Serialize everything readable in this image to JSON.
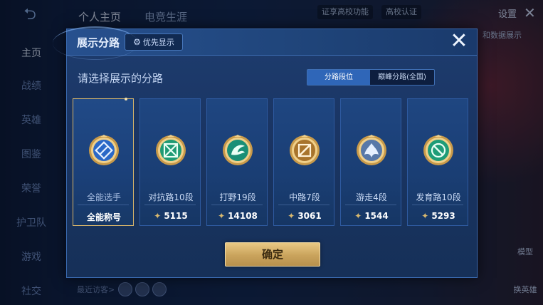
{
  "background": {
    "nav": [
      "主页",
      "战绩",
      "英雄",
      "图鉴",
      "荣誉",
      "护卫队",
      "游戏",
      "社交"
    ],
    "top_tabs": [
      "个人主页",
      "电竞生涯"
    ],
    "verify_tip": "证享高校功能",
    "campus_auth": "高校认证",
    "settings": "设置",
    "data_display": "和数据展示",
    "side_buttons": [
      "模型",
      "换英雄"
    ],
    "recent_visitors": "最近访客>"
  },
  "modal": {
    "title": "展示分路",
    "priority_label": "优先显示",
    "subtitle": "请选择展示的分路",
    "segment": {
      "options": [
        "分路段位",
        "巅峰分路(全国)"
      ],
      "selected": "分路段位"
    },
    "cards": [
      {
        "name": "全能选手",
        "score": "全能称号",
        "selected": true,
        "icon": "all-round-badge-icon",
        "has_star": false
      },
      {
        "name": "对抗路10段",
        "score": "5115",
        "selected": false,
        "icon": "clash-lane-badge-icon",
        "has_star": true
      },
      {
        "name": "打野19段",
        "score": "14108",
        "selected": false,
        "icon": "jungle-badge-icon",
        "has_star": true
      },
      {
        "name": "中路7段",
        "score": "3061",
        "selected": false,
        "icon": "mid-lane-badge-icon",
        "has_star": true
      },
      {
        "name": "游走4段",
        "score": "1544",
        "selected": false,
        "icon": "roam-badge-icon",
        "has_star": true
      },
      {
        "name": "发育路10段",
        "score": "5293",
        "selected": false,
        "icon": "farm-lane-badge-icon",
        "has_star": true
      }
    ],
    "confirm_label": "确定"
  },
  "colors": {
    "accent_gold": "#d9b66a",
    "segment_active": "#2f66b8",
    "modal_bg": "#1a3564"
  }
}
